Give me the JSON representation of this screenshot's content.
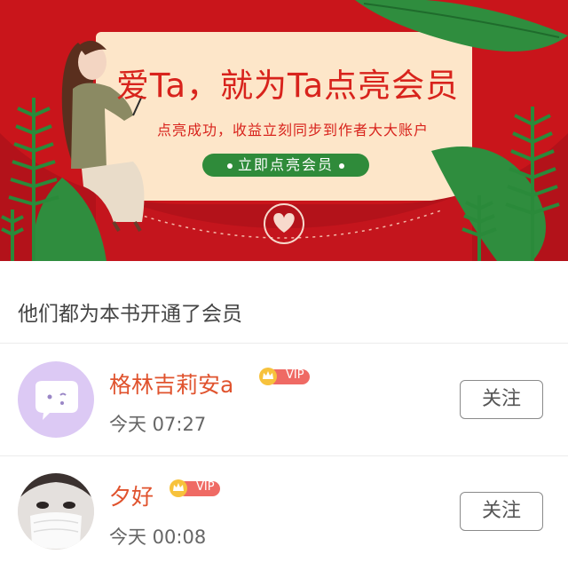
{
  "banner": {
    "title": "爱Ta，就为Ta点亮会员",
    "subtitle": "点亮成功，收益立刻同步到作者大大账户",
    "cta_label": "立即点亮会员"
  },
  "section": {
    "title": "他们都为本书开通了会员"
  },
  "members": [
    {
      "name": "格林吉莉安a",
      "badge": "VIP",
      "time": "今天 07:27",
      "follow_label": "关注"
    },
    {
      "name": "夕好",
      "badge": "VIP",
      "time": "今天 00:08",
      "follow_label": "关注"
    }
  ],
  "colors": {
    "banner_red": "#c9151b",
    "card_cream": "#fde6c9",
    "cta_green": "#2f8b3a",
    "name_orange": "#e0532e"
  }
}
